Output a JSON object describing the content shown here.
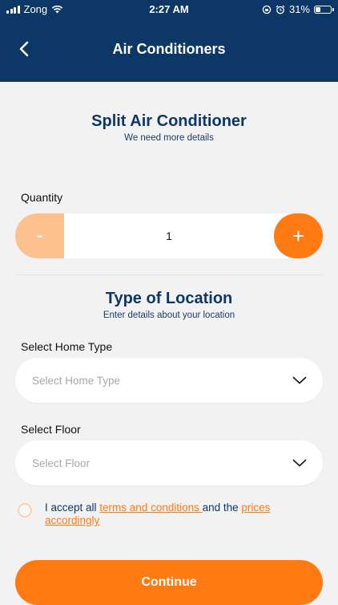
{
  "status_bar": {
    "carrier": "Zong",
    "time": "2:27 AM",
    "battery": "31%",
    "battery_level": 0.31
  },
  "header": {
    "title": "Air Conditioners",
    "back_icon": "chevron-left-icon"
  },
  "product": {
    "title": "Split Air Conditioner",
    "subtitle": "We need more details"
  },
  "quantity": {
    "label": "Quantity",
    "minus_label": "-",
    "value": "1",
    "plus_label": "+"
  },
  "location": {
    "title": "Type of Location",
    "subtitle": "Enter details about your location",
    "home_type_label": "Select Home Type",
    "home_type_placeholder": "Select Home Type",
    "floor_label": "Select Floor",
    "floor_placeholder": "Select Floor"
  },
  "terms": {
    "prefix": "I accept all ",
    "terms_link": "terms and conditions ",
    "middle": "and the ",
    "prices_link": "prices accordingly"
  },
  "continue_label": "Continue",
  "colors": {
    "primary_navy": "#0d3766",
    "accent_orange": "#ff7a12",
    "light_orange": "#fdc08f",
    "background": "#f2f2f2"
  }
}
